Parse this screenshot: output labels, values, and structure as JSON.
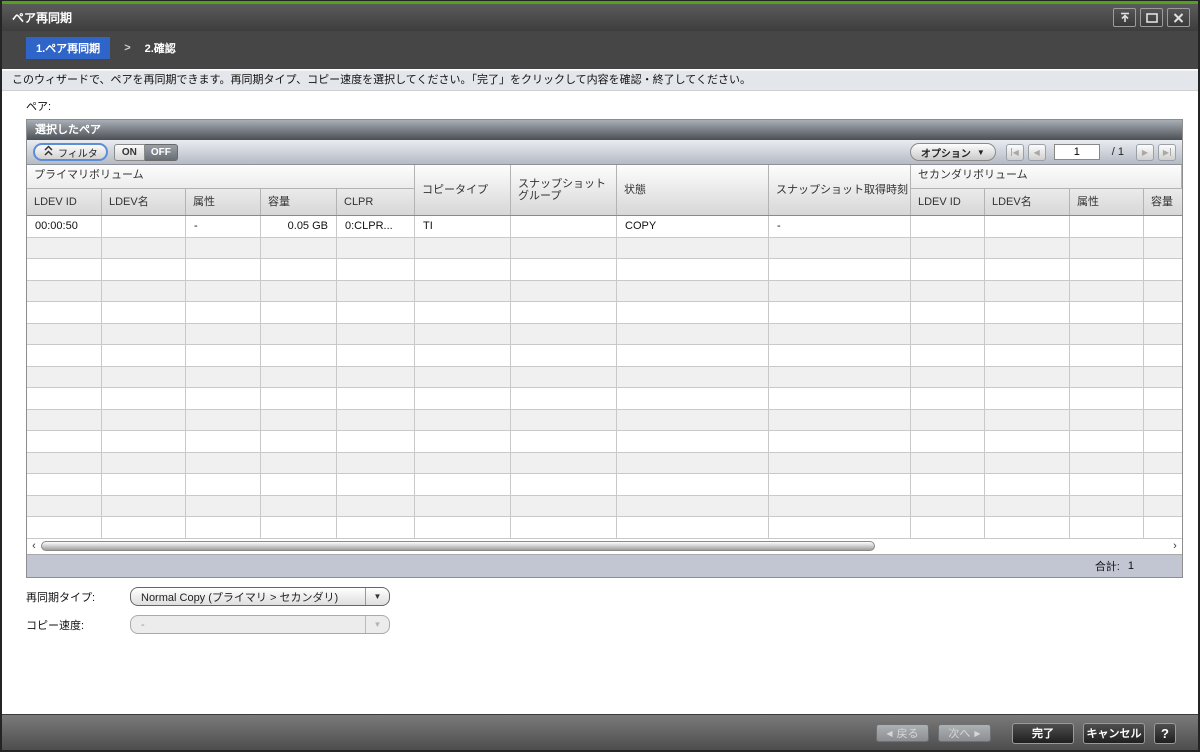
{
  "colors": {
    "brand_green": "#54a21c",
    "breadcrumb_active_bg": "#2f64c8",
    "filter_border_blue": "#5b8ed6",
    "table_footer_bg": "#c2c6d2"
  },
  "window": {
    "title": "ペア再同期",
    "icons": [
      "detach-window-icon",
      "maximize-icon",
      "close-icon"
    ]
  },
  "breadcrumb": {
    "step1": "1.ペア再同期",
    "separator": ">",
    "step2": "2.確認"
  },
  "instruction": "このウィザードで、ペアを再同期できます。再同期タイプ、コピー速度を選択してください。「完了」をクリックして内容を確認・終了してください。",
  "pair_section_label": "ペア:",
  "pair_table": {
    "title": "選択したペア",
    "toolbar": {
      "filter_label": "フィルタ",
      "on_label": "ON",
      "off_label": "OFF",
      "options_label": "オプション"
    },
    "pagination": {
      "page": "1",
      "separator": "/",
      "total": "1"
    },
    "header": {
      "primary_group": "プライマリボリューム",
      "secondary_group": "セカンダリボリューム",
      "primary_cols": [
        "LDEV ID",
        "LDEV名",
        "属性",
        "容量",
        "CLPR"
      ],
      "span_cols": [
        "コピータイプ",
        "スナップショットグループ",
        "状態",
        "スナップショット取得時刻"
      ],
      "secondary_cols": [
        "LDEV ID",
        "LDEV名",
        "属性",
        "容量"
      ]
    },
    "rows": [
      {
        "cells": [
          "00:00:50",
          "",
          "-",
          "0.05 GB",
          "0:CLPR...",
          "TI",
          "",
          "COPY",
          "-",
          "",
          "",
          "",
          ""
        ]
      }
    ],
    "empty_row_count": 14,
    "total_label": "合計:",
    "total_value": "1"
  },
  "controls": {
    "resync_type_label": "再同期タイプ:",
    "resync_type_value": "Normal Copy (プライマリ > セカンダリ)",
    "copy_pace_label": "コピー速度:",
    "copy_pace_value": "-"
  },
  "footer": {
    "back_label": "戻る",
    "next_label": "次へ",
    "finish_label": "完了",
    "cancel_label": "キャンセル",
    "help_label": "?"
  }
}
